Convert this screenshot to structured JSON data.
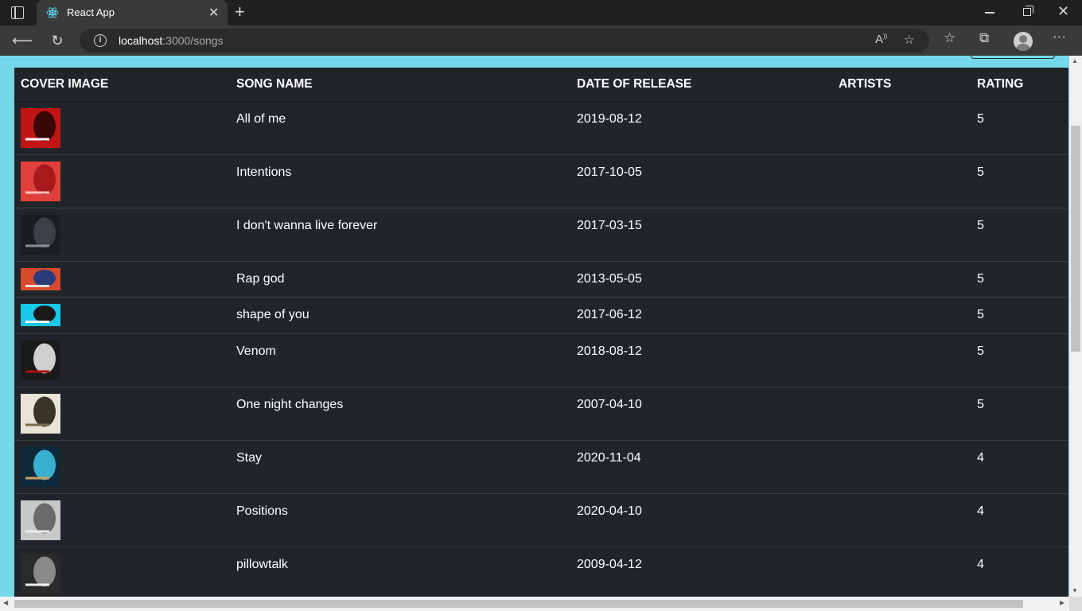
{
  "browser": {
    "tab_title": "React App",
    "url_host": "localhost",
    "url_rest": ":3000/songs"
  },
  "table": {
    "headers": [
      "COVER IMAGE",
      "SONG NAME",
      "DATE OF RELEASE",
      "ARTISTS",
      "RATING"
    ],
    "rows": [
      {
        "name": "All of me",
        "date": "2019-08-12",
        "artists": "",
        "rating": "5",
        "cover_colors": [
          "#c01515",
          "#3a0606",
          "#ffffff"
        ]
      },
      {
        "name": "Intentions",
        "date": "2017-10-05",
        "artists": "",
        "rating": "5",
        "cover_colors": [
          "#e0403c",
          "#a81a1a",
          "#f6c0b8"
        ]
      },
      {
        "name": "I don't wanna live forever",
        "date": "2017-03-15",
        "artists": "",
        "rating": "5",
        "cover_colors": [
          "#1a1d22",
          "#3a3f48",
          "#8a8f98"
        ]
      },
      {
        "name": "Rap god",
        "date": "2013-05-05",
        "artists": "",
        "rating": "5",
        "cover_colors": [
          "#d84a2c",
          "#2a3a7a",
          "#e8e0d8"
        ]
      },
      {
        "name": "shape of you",
        "date": "2017-06-12",
        "artists": "",
        "rating": "5",
        "cover_colors": [
          "#18c8e8",
          "#1a1a1a",
          "#ffffff"
        ]
      },
      {
        "name": "Venom",
        "date": "2018-08-12",
        "artists": "",
        "rating": "5",
        "cover_colors": [
          "#1a1a1a",
          "#d0d0d0",
          "#b01010"
        ]
      },
      {
        "name": "One night changes",
        "date": "2007-04-10",
        "artists": "",
        "rating": "5",
        "cover_colors": [
          "#e8e4d8",
          "#3a3428",
          "#7a6a4a"
        ]
      },
      {
        "name": "Stay",
        "date": "2020-11-04",
        "artists": "",
        "rating": "4",
        "cover_colors": [
          "#0e2a3a",
          "#3ab0d0",
          "#c8a060"
        ]
      },
      {
        "name": "Positions",
        "date": "2020-04-10",
        "artists": "",
        "rating": "4",
        "cover_colors": [
          "#c8c8c8",
          "#6a6a6a",
          "#ececec"
        ]
      },
      {
        "name": "pillowtalk",
        "date": "2009-04-12",
        "artists": "",
        "rating": "4",
        "cover_colors": [
          "#2a2a2a",
          "#8a8a8a",
          "#f0f0f0"
        ]
      }
    ]
  }
}
